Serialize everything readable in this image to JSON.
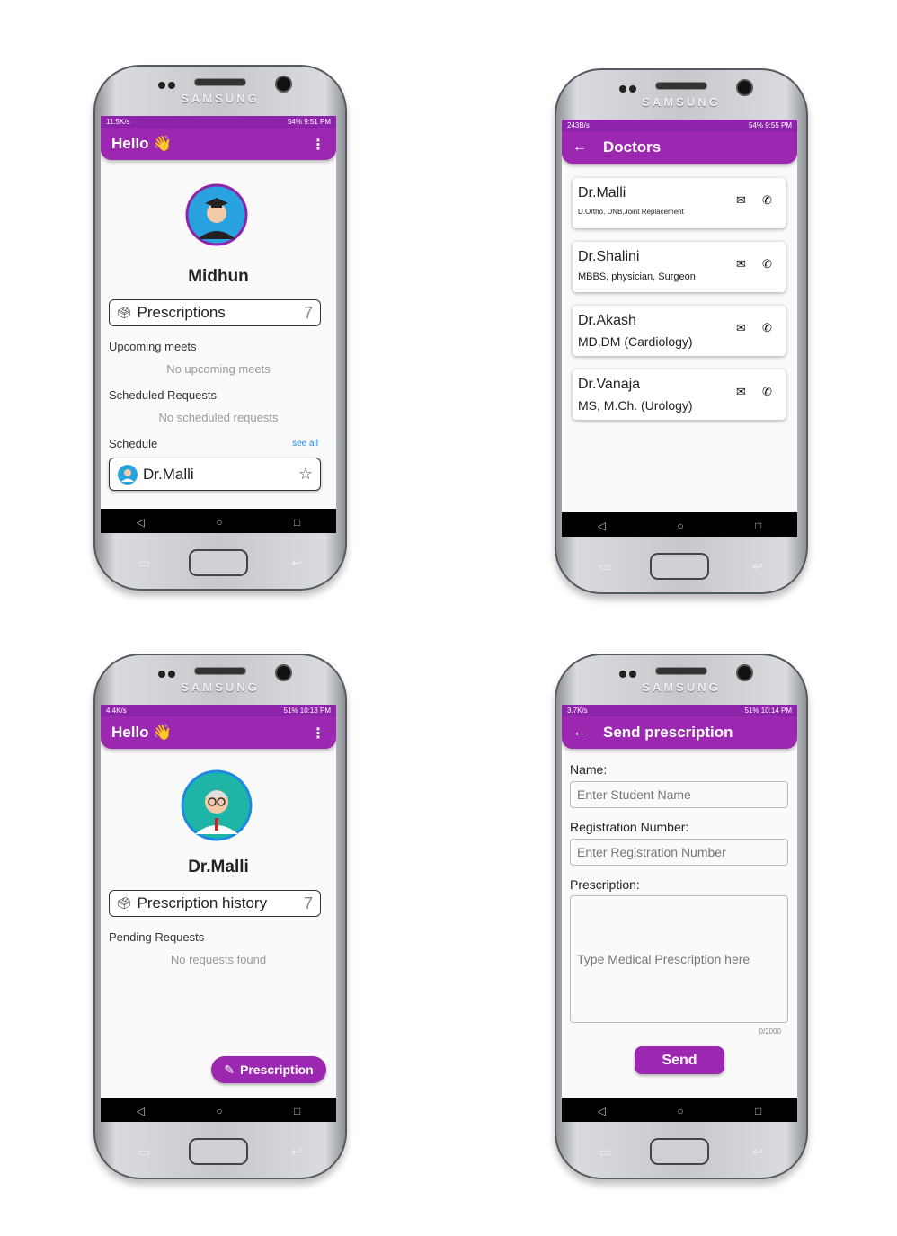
{
  "phone1": {
    "status": {
      "left": "11.5K/s",
      "battery": "54%",
      "time": "9:51 PM"
    },
    "appbar": {
      "title": "Hello 👋",
      "menu": "⋮"
    },
    "user_name": "Midhun",
    "prescriptions": {
      "label": "Prescriptions",
      "count": "7"
    },
    "upcoming": {
      "label": "Upcoming meets",
      "empty": "No upcoming meets"
    },
    "scheduled": {
      "label": "Scheduled Requests",
      "empty": "No scheduled requests"
    },
    "schedule": {
      "label": "Schedule",
      "see_all": "see all",
      "doctor": "Dr.Malli"
    }
  },
  "phone2": {
    "status": {
      "left": "243B/s",
      "battery": "54%",
      "time": "9:55 PM"
    },
    "appbar": {
      "title": "Doctors"
    },
    "doctors": [
      {
        "name": "Dr.Malli",
        "qual": "D.Ortho, DNB,Joint Replacement"
      },
      {
        "name": "Dr.Shalini",
        "qual": "MBBS, physician, Surgeon"
      },
      {
        "name": "Dr.Akash",
        "qual": "MD,DM (Cardiology)"
      },
      {
        "name": "Dr.Vanaja",
        "qual": "MS, M.Ch. (Urology)"
      }
    ]
  },
  "phone3": {
    "status": {
      "left": "4.4K/s",
      "battery": "51%",
      "time": "10:13 PM"
    },
    "appbar": {
      "title": "Hello 👋",
      "menu": "⋮"
    },
    "doctor_name": "Dr.Malli",
    "history": {
      "label": "Prescription history",
      "count": "7"
    },
    "pending": {
      "label": "Pending Requests",
      "empty": "No requests found"
    },
    "fab": "Prescription"
  },
  "phone4": {
    "status": {
      "left": "3.7K/s",
      "battery": "51%",
      "time": "10:14 PM"
    },
    "appbar": {
      "title": "Send prescription"
    },
    "name_label": "Name:",
    "name_placeholder": "Enter Student Name",
    "reg_label": "Registration Number:",
    "reg_placeholder": "Enter Registration Number",
    "presc_label": "Prescription:",
    "presc_placeholder": "Type Medical Prescription here",
    "counter": "0/2000",
    "send": "Send"
  },
  "brand": "SAMSUNG",
  "colors": {
    "purple": "#9c27b0",
    "link": "#1e88e5"
  }
}
